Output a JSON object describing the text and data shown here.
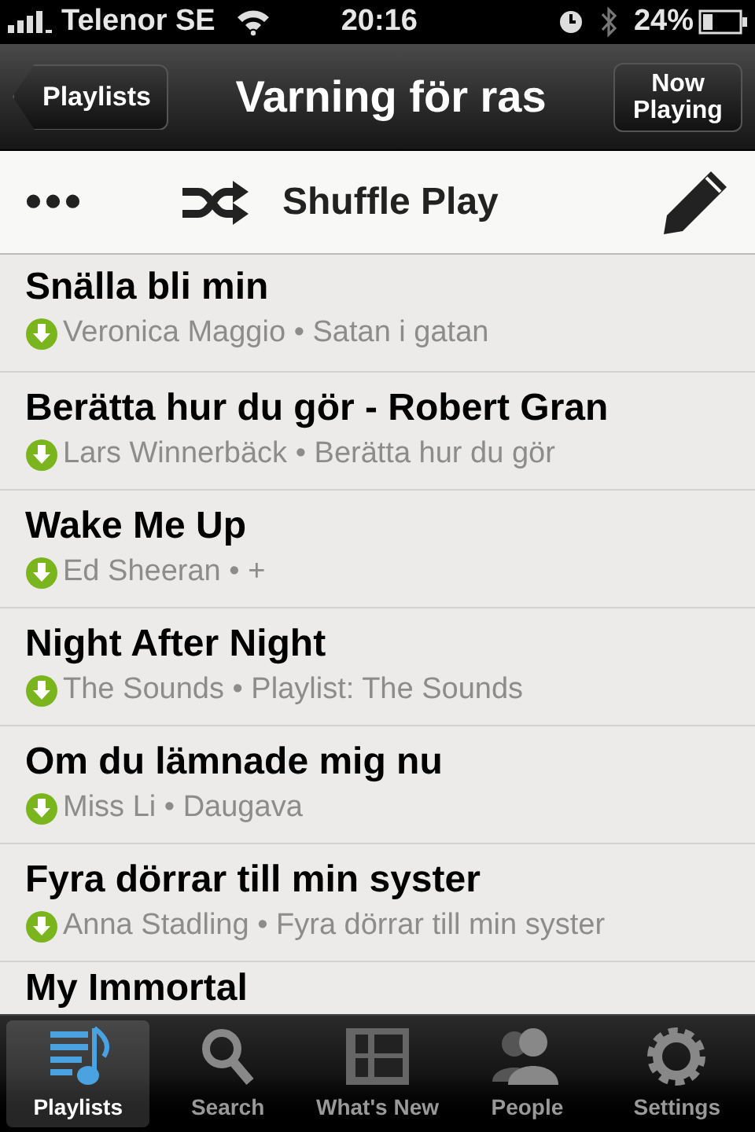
{
  "status_bar": {
    "carrier": "Telenor SE",
    "time": "20:16",
    "battery": "24%"
  },
  "nav_bar": {
    "back": "Playlists",
    "title": "Varning för ras",
    "right_button": "Now Playing"
  },
  "toolbar": {
    "more": "•••",
    "shuffle": "Shuffle Play"
  },
  "tracks": [
    {
      "title": "Snälla bli min",
      "downloaded": true,
      "subtitle": "Veronica Maggio • Satan i gatan"
    },
    {
      "title": "Berätta hur du gör - Robert Gran",
      "downloaded": true,
      "subtitle": "Lars Winnerbäck • Berätta hur du gör"
    },
    {
      "title": "Wake Me Up",
      "downloaded": true,
      "subtitle": "Ed Sheeran • +"
    },
    {
      "title": "Night After Night",
      "downloaded": true,
      "subtitle": "The Sounds • Playlist: The Sounds"
    },
    {
      "title": "Om du lämnade mig nu",
      "downloaded": true,
      "subtitle": "Miss Li • Daugava"
    },
    {
      "title": "Fyra dörrar till min syster",
      "downloaded": true,
      "subtitle": "Anna Stadling • Fyra dörrar till min syster"
    },
    {
      "title": "My Immortal"
    }
  ],
  "tab_bar": [
    {
      "label": "Playlists",
      "selected": true
    },
    {
      "label": "Search",
      "selected": false
    },
    {
      "label": "What's New",
      "selected": false
    },
    {
      "label": "People",
      "selected": false
    },
    {
      "label": "Settings",
      "selected": false
    }
  ]
}
